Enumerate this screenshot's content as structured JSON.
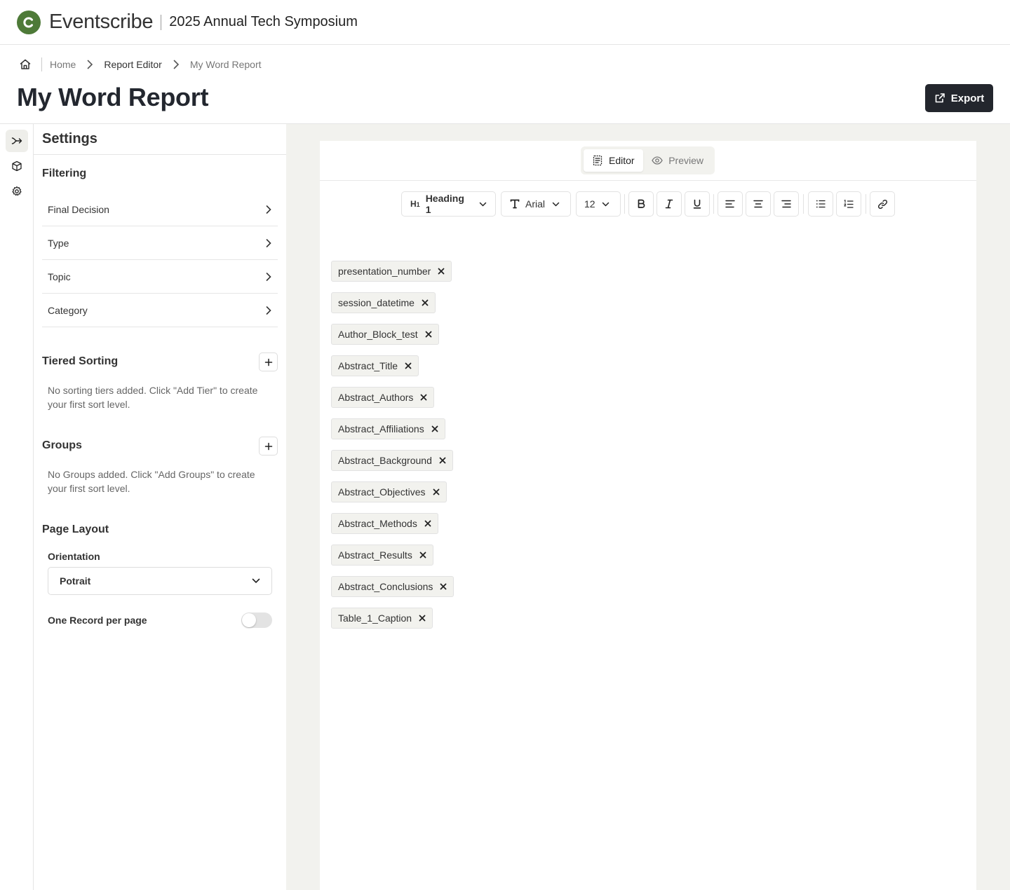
{
  "header": {
    "brand": "Eventscribe",
    "event_title": "2025 Annual Tech Symposium"
  },
  "breadcrumb": {
    "items": [
      "Home",
      "Report Editor",
      "My Word Report"
    ]
  },
  "page": {
    "title": "My Word Report",
    "export_label": "Export"
  },
  "settings": {
    "title": "Settings",
    "filtering": {
      "title": "Filtering",
      "items": [
        "Final Decision",
        "Type",
        "Topic",
        "Category"
      ]
    },
    "tiered_sorting": {
      "title": "Tiered Sorting",
      "hint": "No sorting tiers added. Click \"Add Tier\" to create your first sort level."
    },
    "groups": {
      "title": "Groups",
      "hint": "No Groups added. Click \"Add Groups\" to create your first sort level."
    },
    "page_layout": {
      "title": "Page Layout",
      "orientation_label": "Orientation",
      "orientation_value": "Potrait",
      "one_record_label": "One Record per page",
      "one_record_on": false
    }
  },
  "editor": {
    "tabs": {
      "editor": "Editor",
      "preview": "Preview",
      "active": "Editor"
    },
    "toolbar": {
      "heading": "Heading 1",
      "font": "Arial",
      "size": "12"
    },
    "chips": [
      "presentation_number",
      "session_datetime",
      "Author_Block_test",
      "Abstract_Title",
      "Abstract_Authors",
      "Abstract_Affiliations",
      "Abstract_Background",
      "Abstract_Objectives",
      "Abstract_Methods",
      "Abstract_Results",
      "Abstract_Conclusions",
      "Table_1_Caption"
    ]
  },
  "colors": {
    "brand": "#4e7a38",
    "primary_button": "#23262d",
    "canvas": "#f2f2ee"
  }
}
